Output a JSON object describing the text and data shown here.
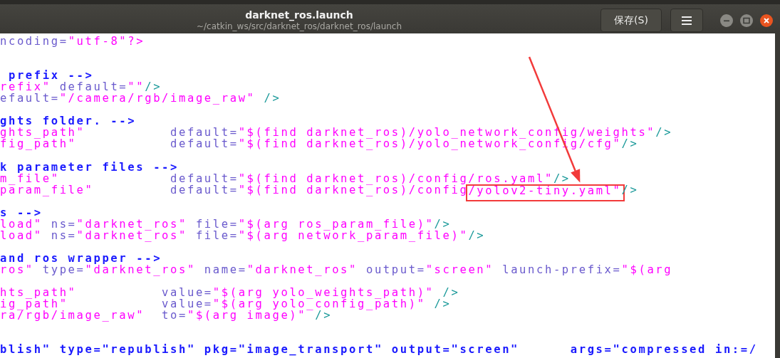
{
  "window": {
    "title": "darknet_ros.launch",
    "subtitle": "~/catkin_ws/src/darknet_ros/darknet_ros/launch",
    "buttons": [
      {
        "kind": "text",
        "label": "保存(S)"
      },
      {
        "kind": "menu"
      }
    ],
    "controls": [
      {
        "kind": "minimize"
      },
      {
        "kind": "maximize"
      },
      {
        "kind": "close"
      }
    ]
  },
  "editor": {
    "lines": [
      {
        "kind": "code",
        "segments": [
          {
            "kind": "attr",
            "text": "ncoding="
          },
          {
            "kind": "string",
            "text": "\"utf-8\"?>"
          }
        ]
      },
      {
        "kind": "blank"
      },
      {
        "kind": "blank"
      },
      {
        "kind": "code",
        "segments": [
          {
            "kind": "comment",
            "text": " prefix -->"
          }
        ]
      },
      {
        "kind": "code",
        "segments": [
          {
            "kind": "string",
            "text": "refix\""
          },
          {
            "kind": "attr",
            "text": " default="
          },
          {
            "kind": "string",
            "text": "\"\""
          },
          {
            "kind": "tag",
            "text": "/>"
          }
        ]
      },
      {
        "kind": "code",
        "segments": [
          {
            "kind": "attr",
            "text": "efault="
          },
          {
            "kind": "string",
            "text": "\"/camera/rgb/image_raw\""
          },
          {
            "kind": "tag",
            "text": " />"
          }
        ]
      },
      {
        "kind": "blank"
      },
      {
        "kind": "code",
        "segments": [
          {
            "kind": "comment",
            "text": "ghts folder. -->"
          }
        ]
      },
      {
        "kind": "code",
        "segments": [
          {
            "kind": "string",
            "text": "ghts_path\""
          },
          {
            "kind": "attr",
            "text": "          default="
          },
          {
            "kind": "string",
            "text": "\"$(find darknet_ros)/yolo_network_config/weights\""
          },
          {
            "kind": "tag",
            "text": "/>"
          }
        ]
      },
      {
        "kind": "code",
        "segments": [
          {
            "kind": "string",
            "text": "fig_path\""
          },
          {
            "kind": "attr",
            "text": "           default="
          },
          {
            "kind": "string",
            "text": "\"$(find darknet_ros)/yolo_network_config/cfg\""
          },
          {
            "kind": "tag",
            "text": "/>"
          }
        ]
      },
      {
        "kind": "blank"
      },
      {
        "kind": "code",
        "segments": [
          {
            "kind": "comment",
            "text": "k parameter files -->"
          }
        ]
      },
      {
        "kind": "code",
        "segments": [
          {
            "kind": "string",
            "text": "m_file\""
          },
          {
            "kind": "attr",
            "text": "             default="
          },
          {
            "kind": "string",
            "text": "\"$(find darknet_ros)/config/ros.yaml\""
          },
          {
            "kind": "tag",
            "text": "/>"
          }
        ]
      },
      {
        "kind": "code",
        "segments": [
          {
            "kind": "string",
            "text": "param_file\""
          },
          {
            "kind": "attr",
            "text": "         default="
          },
          {
            "kind": "string",
            "text": "\"$(find darknet_ros)/config"
          },
          {
            "kind": "string",
            "text": "/yolov2-tiny.yaml\"",
            "highlighted": true
          },
          {
            "kind": "tag",
            "text": "/>"
          }
        ]
      },
      {
        "kind": "blank"
      },
      {
        "kind": "code",
        "segments": [
          {
            "kind": "comment",
            "text": "s -->"
          }
        ]
      },
      {
        "kind": "code",
        "segments": [
          {
            "kind": "string",
            "text": "load\""
          },
          {
            "kind": "attr",
            "text": " ns="
          },
          {
            "kind": "string",
            "text": "\"darknet_ros\""
          },
          {
            "kind": "attr",
            "text": " file="
          },
          {
            "kind": "string",
            "text": "\"$(arg ros_param_file)\""
          },
          {
            "kind": "tag",
            "text": "/>"
          }
        ]
      },
      {
        "kind": "code",
        "segments": [
          {
            "kind": "string",
            "text": "load\""
          },
          {
            "kind": "attr",
            "text": " ns="
          },
          {
            "kind": "string",
            "text": "\"darknet_ros\""
          },
          {
            "kind": "attr",
            "text": " file="
          },
          {
            "kind": "string",
            "text": "\"$(arg network_param_file)\""
          },
          {
            "kind": "tag",
            "text": "/>"
          }
        ]
      },
      {
        "kind": "blank"
      },
      {
        "kind": "code",
        "segments": [
          {
            "kind": "comment",
            "text": "and ros wrapper -->"
          }
        ]
      },
      {
        "kind": "code",
        "segments": [
          {
            "kind": "string",
            "text": "ros\""
          },
          {
            "kind": "attr",
            "text": " type="
          },
          {
            "kind": "string",
            "text": "\"darknet_ros\""
          },
          {
            "kind": "attr",
            "text": " name="
          },
          {
            "kind": "string",
            "text": "\"darknet_ros\""
          },
          {
            "kind": "attr",
            "text": " output="
          },
          {
            "kind": "string",
            "text": "\"screen\""
          },
          {
            "kind": "attr",
            "text": " launch-prefix="
          },
          {
            "kind": "string",
            "text": "\"$(arg"
          }
        ]
      },
      {
        "kind": "blank"
      },
      {
        "kind": "code",
        "segments": [
          {
            "kind": "string",
            "text": "hts_path\""
          },
          {
            "kind": "attr",
            "text": "          value="
          },
          {
            "kind": "string",
            "text": "\"$(arg yolo_weights_path)\""
          },
          {
            "kind": "tag",
            "text": " />"
          }
        ]
      },
      {
        "kind": "code",
        "segments": [
          {
            "kind": "string",
            "text": "ig_path\""
          },
          {
            "kind": "attr",
            "text": "           value="
          },
          {
            "kind": "string",
            "text": "\"$(arg yolo_config_path)\""
          },
          {
            "kind": "tag",
            "text": " />"
          }
        ]
      },
      {
        "kind": "code",
        "segments": [
          {
            "kind": "string",
            "text": "ra/rgb/image_raw\""
          },
          {
            "kind": "attr",
            "text": "  to="
          },
          {
            "kind": "string",
            "text": "\"$(arg image)\""
          },
          {
            "kind": "tag",
            "text": " />"
          }
        ]
      },
      {
        "kind": "blank"
      },
      {
        "kind": "blank"
      },
      {
        "kind": "code",
        "segments": [
          {
            "kind": "comment",
            "text": "blish\" type=\"republish\" pkg=\"image_transport\" output=\"screen\"      args=\"compressed in:=/"
          }
        ]
      }
    ]
  },
  "annotations": [
    {
      "kind": "arrow"
    }
  ]
}
